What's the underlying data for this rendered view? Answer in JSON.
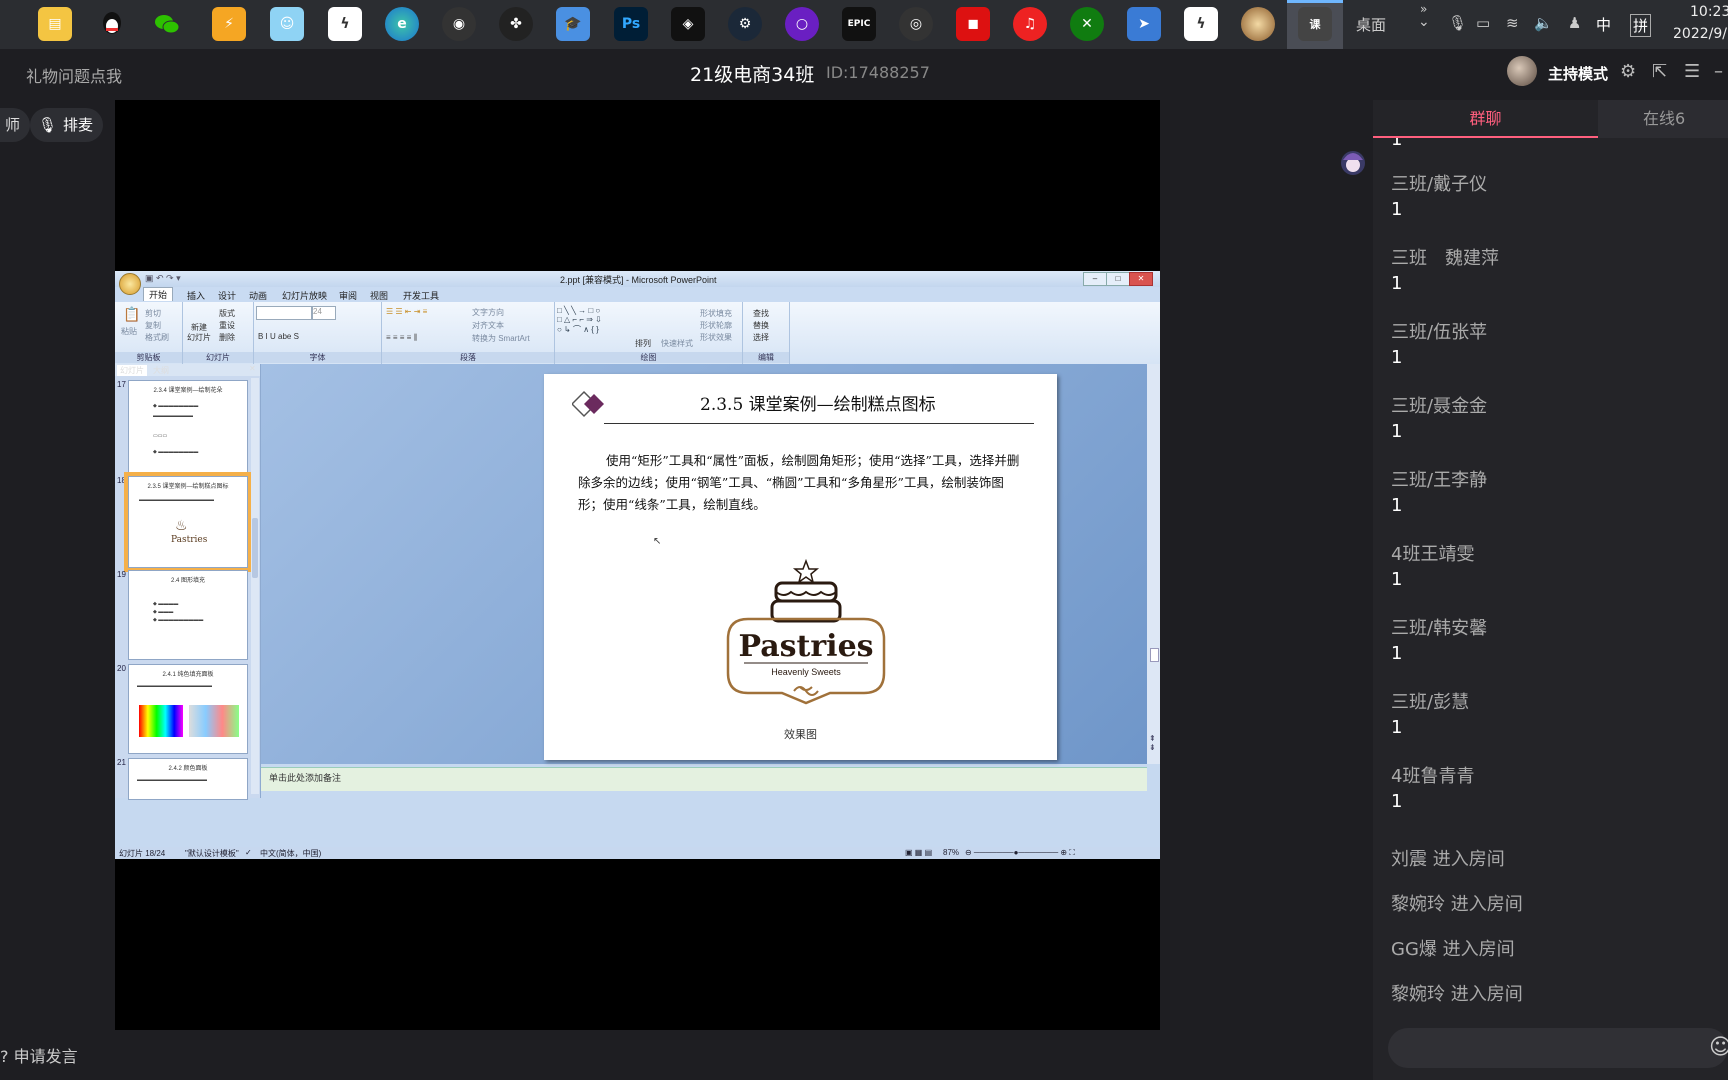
{
  "taskbar": {
    "icons": [
      "file-explorer-icon",
      "qq-icon",
      "wechat-icon",
      "security-icon",
      "game-char-icon",
      "thunder-icon",
      "edge-icon",
      "obs-icon",
      "davinci-icon",
      "classroom-icon",
      "photoshop-icon",
      "gamebox-icon",
      "steam-icon",
      "purple-circle-icon",
      "epic-games-icon",
      "swirl-icon",
      "bag-icon",
      "netease-music-icon",
      "xbox-icon",
      "feishu-icon",
      "thunder-app-icon",
      "avatar-app-icon",
      "class-app-icon"
    ],
    "ps_label": "Ps",
    "epic_label": "EPIC",
    "desktop_label": "桌面",
    "ime_label": "中",
    "ime2_label": "拼",
    "time": "10:23",
    "date": "2022/9/"
  },
  "header": {
    "gift_link": "礼物问题点我",
    "class_title": "21级电商34班",
    "class_id": "ID:17488257",
    "host_mode": "主持模式"
  },
  "left": {
    "teacher_label": "师",
    "queue_label": "排麦",
    "speak_label": "申请发言"
  },
  "ppt": {
    "window_title": "2.ppt [兼容模式] - Microsoft PowerPoint",
    "tabs": [
      "开始",
      "插入",
      "设计",
      "动画",
      "幻灯片放映",
      "审阅",
      "视图",
      "开发工具"
    ],
    "ribbon": {
      "clipboard": {
        "paste": "粘贴",
        "cut": "剪切",
        "copy": "复制",
        "format": "格式刷",
        "label": "剪贴板"
      },
      "slides": {
        "new": "新建",
        "new2": "幻灯片",
        "layout": "版式",
        "reset": "重设",
        "delete": "删除",
        "label": "幻灯片"
      },
      "font": {
        "size": "24",
        "label": "字体"
      },
      "paragraph": {
        "text_dir": "文字方向",
        "align": "对齐文本",
        "smartart": "转换为 SmartArt",
        "label": "段落"
      },
      "drawing": {
        "arrange": "排列",
        "quick": "快速样式",
        "fill": "形状填充",
        "outline": "形状轮廓",
        "effect": "形状效果",
        "label": "绘图"
      },
      "editing": {
        "find": "查找",
        "replace": "替换",
        "select": "选择",
        "label": "编辑"
      }
    },
    "pane_tabs": [
      "幻灯片",
      "大纲"
    ],
    "thumbs": [
      {
        "num": "17",
        "title": "2.3.4 课堂案例—绘制花朵"
      },
      {
        "num": "18",
        "title": "2.3.5 课堂案例—绘制糕点图标"
      },
      {
        "num": "19",
        "title": "2.4 图形填充"
      },
      {
        "num": "20",
        "title": "2.4.1 纯色填充面板"
      },
      {
        "num": "21",
        "title": "2.4.2 颜色面板"
      }
    ],
    "slide": {
      "title": "2.3.5 课堂案例—绘制糕点图标",
      "body": "使用“矩形”工具和“属性”面板，绘制圆角矩形；使用“选择”工具，选择并删除多余的边线；使用“钢笔”工具、“椭圆”工具和“多角星形”工具，绘制装饰图形；使用“线条”工具，绘制直线。",
      "logo_text": "Pastries",
      "logo_sub": "Heavenly Sweets",
      "caption": "效果图"
    },
    "notes": "单击此处添加备注",
    "status": {
      "slide_pos": "幻灯片 18/24",
      "theme": "\"默认设计模板\"",
      "lang": "中文(简体，中国)",
      "zoom": "87%"
    }
  },
  "chat": {
    "tab_group": "群聊",
    "tab_online": "在线6",
    "messages": [
      {
        "name": "",
        "text": "1"
      },
      {
        "name": "三班/戴子仪",
        "text": "1"
      },
      {
        "name": "三班　魏建萍",
        "text": "1"
      },
      {
        "name": "三班/伍张苹",
        "text": "1"
      },
      {
        "name": "三班/聂金金",
        "text": "1"
      },
      {
        "name": "三班/王李静",
        "text": "1"
      },
      {
        "name": "4班王靖雯",
        "text": "1"
      },
      {
        "name": "三班/韩安馨",
        "text": "1"
      },
      {
        "name": "三班/彭慧",
        "text": "1"
      },
      {
        "name": "4班鲁青青",
        "text": "1"
      }
    ],
    "enters": [
      "刘震 进入房间",
      "黎婉玲 进入房间",
      "GG爆 进入房间",
      "黎婉玲 进入房间"
    ]
  }
}
